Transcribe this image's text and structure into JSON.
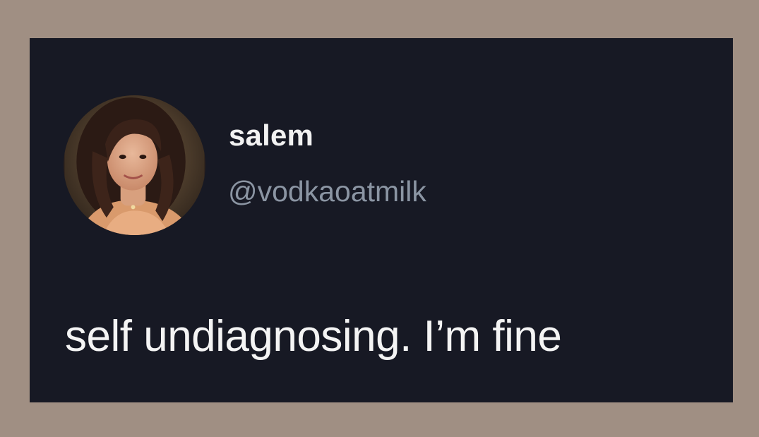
{
  "tweet": {
    "display_name": "salem",
    "handle": "@vodkaoatmilk",
    "text": "self undiagnosing. I’m fine"
  },
  "colors": {
    "page_background": "#a08f83",
    "card_background": "#171924",
    "name_color": "#f2f2f2",
    "handle_color": "#8b95a3",
    "text_color": "#f4f4f4"
  },
  "icons": {
    "avatar": "profile-photo"
  }
}
